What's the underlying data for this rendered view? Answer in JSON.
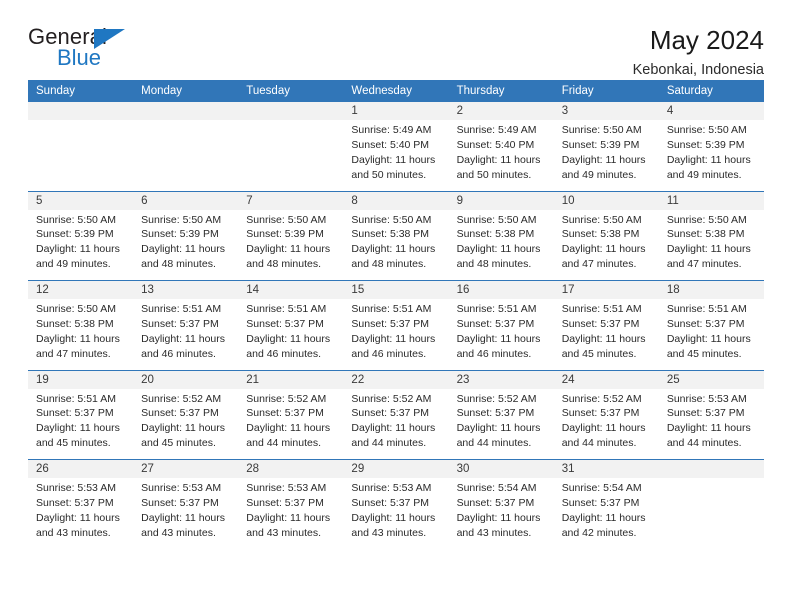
{
  "brand": {
    "name_part1": "General",
    "name_part2": "Blue",
    "triangle_icon": "triangle-icon",
    "accent_color": "#1f77c2"
  },
  "header": {
    "title": "May 2024",
    "location": "Kebonkai, Indonesia"
  },
  "colors": {
    "header_blue": "#3176b8",
    "daynum_band": "#f2f2f2",
    "text": "#2a2a2a"
  },
  "weekday_headers": [
    "Sunday",
    "Monday",
    "Tuesday",
    "Wednesday",
    "Thursday",
    "Friday",
    "Saturday"
  ],
  "weeks": [
    {
      "daynums": [
        "",
        "",
        "",
        "1",
        "2",
        "3",
        "4"
      ],
      "cells": [
        {
          "sunrise": "",
          "sunset": "",
          "daylight_line1": "",
          "daylight_line2": ""
        },
        {
          "sunrise": "",
          "sunset": "",
          "daylight_line1": "",
          "daylight_line2": ""
        },
        {
          "sunrise": "",
          "sunset": "",
          "daylight_line1": "",
          "daylight_line2": ""
        },
        {
          "sunrise": "Sunrise: 5:49 AM",
          "sunset": "Sunset: 5:40 PM",
          "daylight_line1": "Daylight: 11 hours",
          "daylight_line2": "and 50 minutes."
        },
        {
          "sunrise": "Sunrise: 5:49 AM",
          "sunset": "Sunset: 5:40 PM",
          "daylight_line1": "Daylight: 11 hours",
          "daylight_line2": "and 50 minutes."
        },
        {
          "sunrise": "Sunrise: 5:50 AM",
          "sunset": "Sunset: 5:39 PM",
          "daylight_line1": "Daylight: 11 hours",
          "daylight_line2": "and 49 minutes."
        },
        {
          "sunrise": "Sunrise: 5:50 AM",
          "sunset": "Sunset: 5:39 PM",
          "daylight_line1": "Daylight: 11 hours",
          "daylight_line2": "and 49 minutes."
        }
      ]
    },
    {
      "daynums": [
        "5",
        "6",
        "7",
        "8",
        "9",
        "10",
        "11"
      ],
      "cells": [
        {
          "sunrise": "Sunrise: 5:50 AM",
          "sunset": "Sunset: 5:39 PM",
          "daylight_line1": "Daylight: 11 hours",
          "daylight_line2": "and 49 minutes."
        },
        {
          "sunrise": "Sunrise: 5:50 AM",
          "sunset": "Sunset: 5:39 PM",
          "daylight_line1": "Daylight: 11 hours",
          "daylight_line2": "and 48 minutes."
        },
        {
          "sunrise": "Sunrise: 5:50 AM",
          "sunset": "Sunset: 5:39 PM",
          "daylight_line1": "Daylight: 11 hours",
          "daylight_line2": "and 48 minutes."
        },
        {
          "sunrise": "Sunrise: 5:50 AM",
          "sunset": "Sunset: 5:38 PM",
          "daylight_line1": "Daylight: 11 hours",
          "daylight_line2": "and 48 minutes."
        },
        {
          "sunrise": "Sunrise: 5:50 AM",
          "sunset": "Sunset: 5:38 PM",
          "daylight_line1": "Daylight: 11 hours",
          "daylight_line2": "and 48 minutes."
        },
        {
          "sunrise": "Sunrise: 5:50 AM",
          "sunset": "Sunset: 5:38 PM",
          "daylight_line1": "Daylight: 11 hours",
          "daylight_line2": "and 47 minutes."
        },
        {
          "sunrise": "Sunrise: 5:50 AM",
          "sunset": "Sunset: 5:38 PM",
          "daylight_line1": "Daylight: 11 hours",
          "daylight_line2": "and 47 minutes."
        }
      ]
    },
    {
      "daynums": [
        "12",
        "13",
        "14",
        "15",
        "16",
        "17",
        "18"
      ],
      "cells": [
        {
          "sunrise": "Sunrise: 5:50 AM",
          "sunset": "Sunset: 5:38 PM",
          "daylight_line1": "Daylight: 11 hours",
          "daylight_line2": "and 47 minutes."
        },
        {
          "sunrise": "Sunrise: 5:51 AM",
          "sunset": "Sunset: 5:37 PM",
          "daylight_line1": "Daylight: 11 hours",
          "daylight_line2": "and 46 minutes."
        },
        {
          "sunrise": "Sunrise: 5:51 AM",
          "sunset": "Sunset: 5:37 PM",
          "daylight_line1": "Daylight: 11 hours",
          "daylight_line2": "and 46 minutes."
        },
        {
          "sunrise": "Sunrise: 5:51 AM",
          "sunset": "Sunset: 5:37 PM",
          "daylight_line1": "Daylight: 11 hours",
          "daylight_line2": "and 46 minutes."
        },
        {
          "sunrise": "Sunrise: 5:51 AM",
          "sunset": "Sunset: 5:37 PM",
          "daylight_line1": "Daylight: 11 hours",
          "daylight_line2": "and 46 minutes."
        },
        {
          "sunrise": "Sunrise: 5:51 AM",
          "sunset": "Sunset: 5:37 PM",
          "daylight_line1": "Daylight: 11 hours",
          "daylight_line2": "and 45 minutes."
        },
        {
          "sunrise": "Sunrise: 5:51 AM",
          "sunset": "Sunset: 5:37 PM",
          "daylight_line1": "Daylight: 11 hours",
          "daylight_line2": "and 45 minutes."
        }
      ]
    },
    {
      "daynums": [
        "19",
        "20",
        "21",
        "22",
        "23",
        "24",
        "25"
      ],
      "cells": [
        {
          "sunrise": "Sunrise: 5:51 AM",
          "sunset": "Sunset: 5:37 PM",
          "daylight_line1": "Daylight: 11 hours",
          "daylight_line2": "and 45 minutes."
        },
        {
          "sunrise": "Sunrise: 5:52 AM",
          "sunset": "Sunset: 5:37 PM",
          "daylight_line1": "Daylight: 11 hours",
          "daylight_line2": "and 45 minutes."
        },
        {
          "sunrise": "Sunrise: 5:52 AM",
          "sunset": "Sunset: 5:37 PM",
          "daylight_line1": "Daylight: 11 hours",
          "daylight_line2": "and 44 minutes."
        },
        {
          "sunrise": "Sunrise: 5:52 AM",
          "sunset": "Sunset: 5:37 PM",
          "daylight_line1": "Daylight: 11 hours",
          "daylight_line2": "and 44 minutes."
        },
        {
          "sunrise": "Sunrise: 5:52 AM",
          "sunset": "Sunset: 5:37 PM",
          "daylight_line1": "Daylight: 11 hours",
          "daylight_line2": "and 44 minutes."
        },
        {
          "sunrise": "Sunrise: 5:52 AM",
          "sunset": "Sunset: 5:37 PM",
          "daylight_line1": "Daylight: 11 hours",
          "daylight_line2": "and 44 minutes."
        },
        {
          "sunrise": "Sunrise: 5:53 AM",
          "sunset": "Sunset: 5:37 PM",
          "daylight_line1": "Daylight: 11 hours",
          "daylight_line2": "and 44 minutes."
        }
      ]
    },
    {
      "daynums": [
        "26",
        "27",
        "28",
        "29",
        "30",
        "31",
        ""
      ],
      "cells": [
        {
          "sunrise": "Sunrise: 5:53 AM",
          "sunset": "Sunset: 5:37 PM",
          "daylight_line1": "Daylight: 11 hours",
          "daylight_line2": "and 43 minutes."
        },
        {
          "sunrise": "Sunrise: 5:53 AM",
          "sunset": "Sunset: 5:37 PM",
          "daylight_line1": "Daylight: 11 hours",
          "daylight_line2": "and 43 minutes."
        },
        {
          "sunrise": "Sunrise: 5:53 AM",
          "sunset": "Sunset: 5:37 PM",
          "daylight_line1": "Daylight: 11 hours",
          "daylight_line2": "and 43 minutes."
        },
        {
          "sunrise": "Sunrise: 5:53 AM",
          "sunset": "Sunset: 5:37 PM",
          "daylight_line1": "Daylight: 11 hours",
          "daylight_line2": "and 43 minutes."
        },
        {
          "sunrise": "Sunrise: 5:54 AM",
          "sunset": "Sunset: 5:37 PM",
          "daylight_line1": "Daylight: 11 hours",
          "daylight_line2": "and 43 minutes."
        },
        {
          "sunrise": "Sunrise: 5:54 AM",
          "sunset": "Sunset: 5:37 PM",
          "daylight_line1": "Daylight: 11 hours",
          "daylight_line2": "and 42 minutes."
        },
        {
          "sunrise": "",
          "sunset": "",
          "daylight_line1": "",
          "daylight_line2": ""
        }
      ]
    }
  ]
}
